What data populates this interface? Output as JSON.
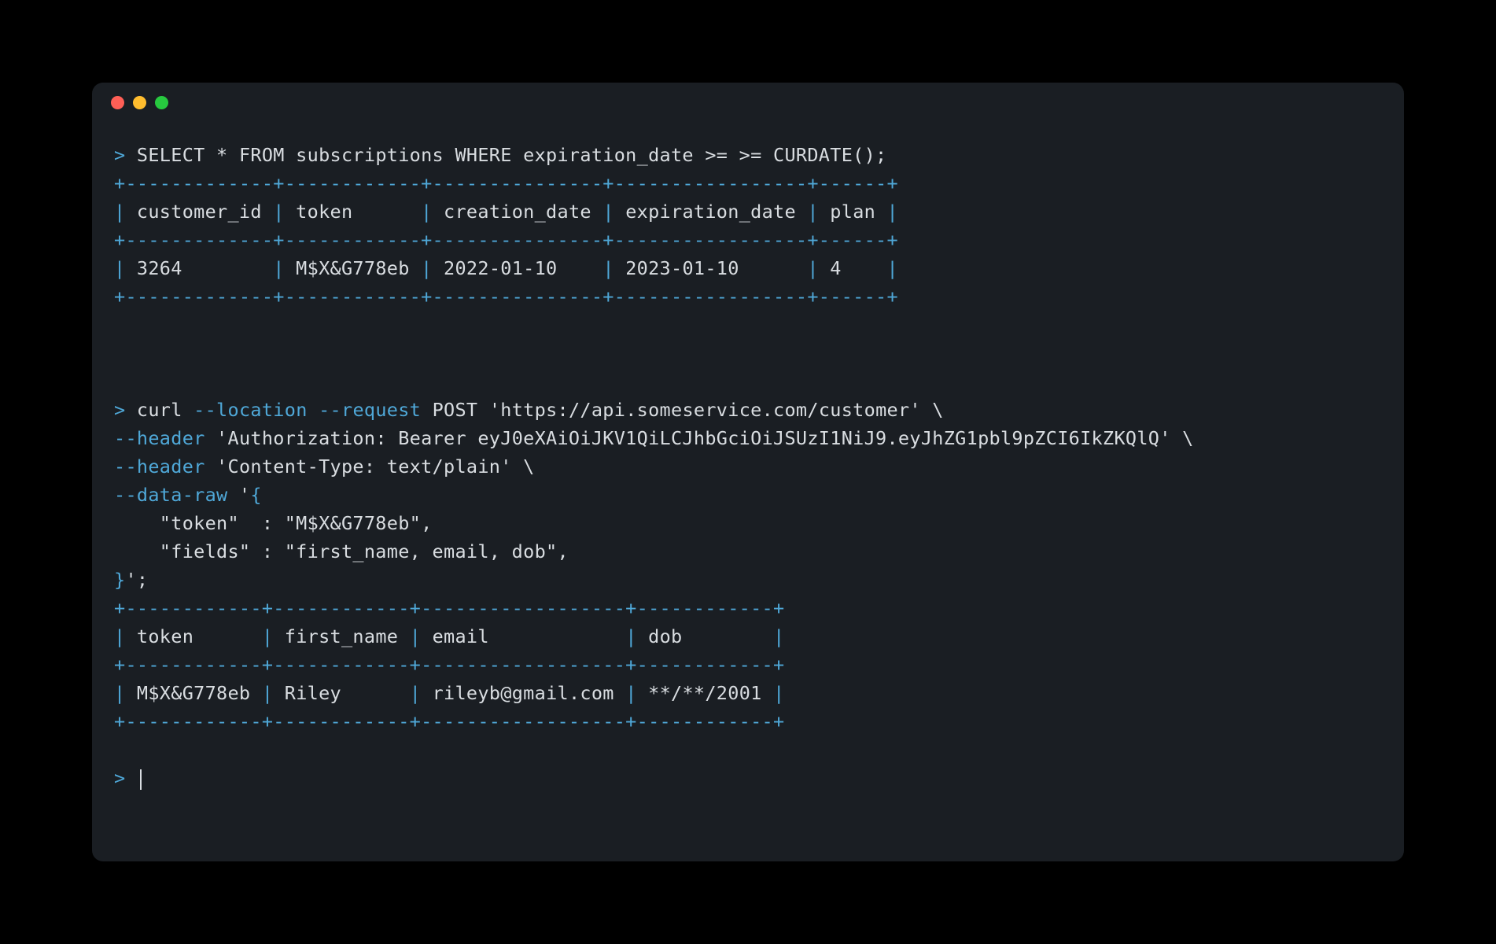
{
  "prompt_symbol": ">",
  "query1": {
    "command": "SELECT * FROM subscriptions WHERE expiration_date >= >= CURDATE();",
    "border_top": "+-------------+------------+---------------+-----------------+------+",
    "header_row": "| customer_id | token      | creation_date | expiration_date | plan |",
    "border_mid": "+-------------+------------+---------------+-----------------+------+",
    "data_row": "| 3264        | M$X&G778eb | 2022-01-10    | 2023-01-10      | 4    |",
    "border_bot": "+-------------+------------+---------------+-----------------+------+"
  },
  "curl": {
    "line1_cmd": "curl ",
    "line1_flag_loc": "--location",
    "line1_space": " ",
    "line1_flag_req": "--request",
    "line1_rest": " POST 'https://api.someservice.com/customer' \\",
    "line2_flag": "--header",
    "line2_rest": " 'Authorization: Bearer eyJ0eXAiOiJKV1QiLCJhbGciOiJSUzI1NiJ9.eyJhZG1pbl9pZCI6IkZKQlQ' \\",
    "line3_flag": "--header",
    "line3_rest": " 'Content-Type: text/plain' \\",
    "line4_flag": "--data-raw",
    "line4_rest": " '",
    "line4_brace": "{",
    "body1": "    \"token\"  : \"M$X&G778eb\",",
    "body2": "    \"fields\" : \"first_name, email, dob\",",
    "line_close_brace": "}",
    "line_close_rest": "';"
  },
  "result2": {
    "border_top": "+------------+------------+------------------+------------+",
    "header_row": "| token      | first_name | email            | dob        |",
    "border_mid": "+------------+------------+------------------+------------+",
    "data_row": "| M$X&G778eb | Riley      | rileyb@gmail.com | **/**/2001 |",
    "border_bot": "+------------+------------+------------------+------------+"
  }
}
